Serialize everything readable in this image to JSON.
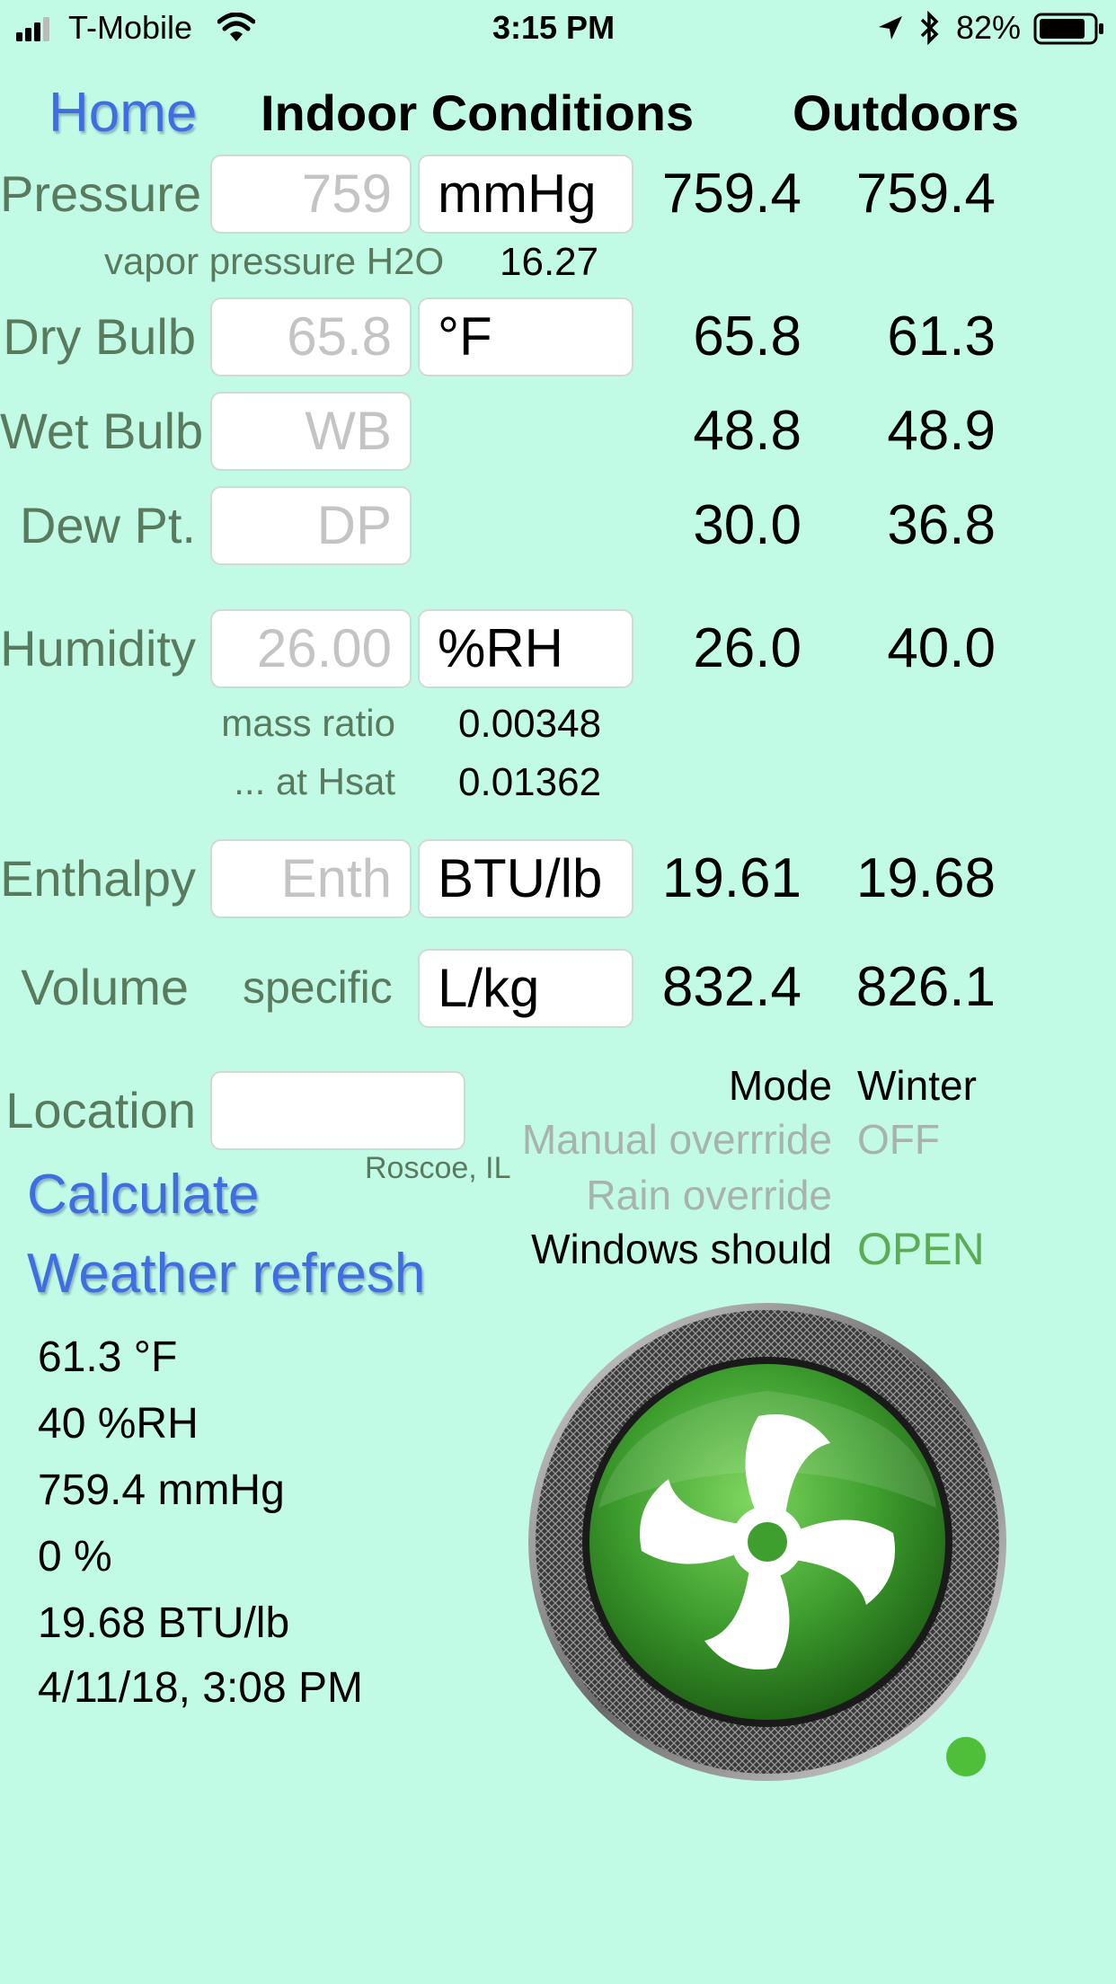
{
  "status_bar": {
    "carrier": "T-Mobile",
    "time": "3:15 PM",
    "battery": "82%"
  },
  "header": {
    "home": "Home",
    "indoor": "Indoor Conditions",
    "outdoors": "Outdoors"
  },
  "rows": {
    "pressure": {
      "label": "Pressure",
      "input": "759",
      "unit": "mmHg",
      "indoor": "759.4",
      "outdoor": "759.4"
    },
    "vapor": {
      "label": "vapor pressure H2O",
      "value": "16.27"
    },
    "dry_bulb": {
      "label": "Dry Bulb",
      "input": "65.8",
      "unit": "°F",
      "indoor": "65.8",
      "outdoor": "61.3"
    },
    "wet_bulb": {
      "label": "Wet Bulb",
      "placeholder": "WB",
      "indoor": "48.8",
      "outdoor": "48.9"
    },
    "dew_pt": {
      "label": "Dew Pt.",
      "placeholder": "DP",
      "indoor": "30.0",
      "outdoor": "36.8"
    },
    "humidity": {
      "label": "Humidity",
      "input": "26.00",
      "unit": "%RH",
      "indoor": "26.0",
      "outdoor": "40.0"
    },
    "mass_ratio": {
      "label": "mass ratio",
      "value": "0.00348"
    },
    "at_hsat": {
      "label": "... at Hsat",
      "value": "0.01362"
    },
    "enthalpy": {
      "label": "Enthalpy",
      "placeholder": "Enth",
      "unit": "BTU/lb",
      "indoor": "19.61",
      "outdoor": "19.68"
    },
    "volume": {
      "label": "Volume",
      "sublabel": "specific",
      "unit": "L/kg",
      "indoor": "832.4",
      "outdoor": "826.1"
    }
  },
  "location": {
    "label": "Location",
    "value": "",
    "city": "Roscoe, IL"
  },
  "actions": {
    "calculate": "Calculate",
    "weather_refresh": "Weather refresh"
  },
  "mode": {
    "mode_label": "Mode",
    "mode_value": "Winter",
    "manual_label": "Manual overrride",
    "manual_value": "OFF",
    "rain_label": "Rain override",
    "rain_value": "",
    "windows_label": "Windows should",
    "windows_value": "OPEN"
  },
  "weather": {
    "temp": "61.3 °F",
    "rh": "40 %RH",
    "pressure": "759.4 mmHg",
    "precip": "0 %",
    "enthalpy": "19.68  BTU/lb",
    "timestamp": "4/11/18, 3:08 PM"
  },
  "colors": {
    "background": "#c1fbe6",
    "label_green": "#5a7a5e",
    "link_blue": "#3f6ee0",
    "fan_green": "#3e9e2e",
    "indicator_green": "#4fbf3a"
  },
  "icons": {
    "fan": "fan-icon",
    "indicator": "status-dot"
  }
}
